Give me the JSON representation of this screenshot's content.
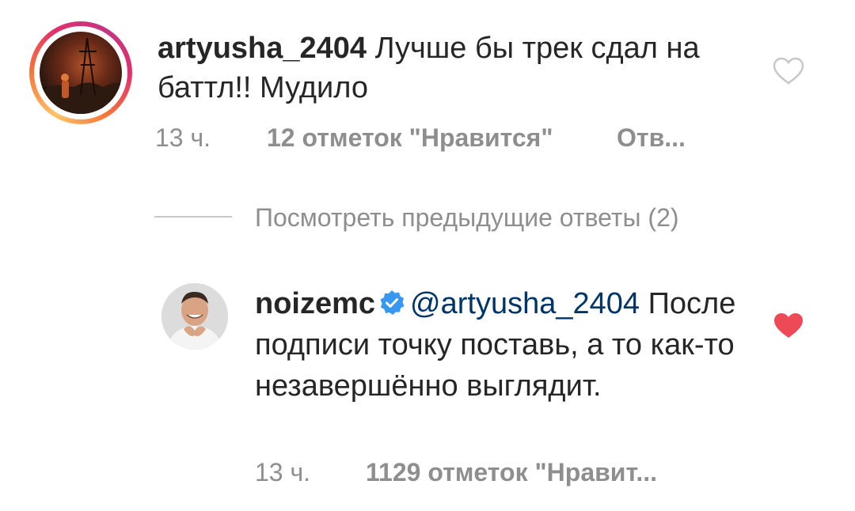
{
  "comment": {
    "username": "artyusha_2404",
    "text": "Лучше бы трек сдал на баттл!! Мудило",
    "time": "13 ч.",
    "likes": "12 отметок \"Нравится\"",
    "reply_label": "Отв...",
    "liked": false
  },
  "view_replies": {
    "label": "Посмотреть предыдущие ответы (2)"
  },
  "reply": {
    "username": "noizemc",
    "verified": true,
    "mention": "@artyusha_2404",
    "text": "После подписи точку поставь, а то как-то незавершённо выглядит.",
    "time": "13 ч.",
    "likes": "1129 отметок \"Нравит...",
    "liked": true
  },
  "colors": {
    "heart_liked": "#ed4956",
    "heart_outline": "#c7c7c7",
    "mention": "#003569",
    "verified_badge": "#3897f0",
    "meta_text": "#8e8e8e"
  }
}
